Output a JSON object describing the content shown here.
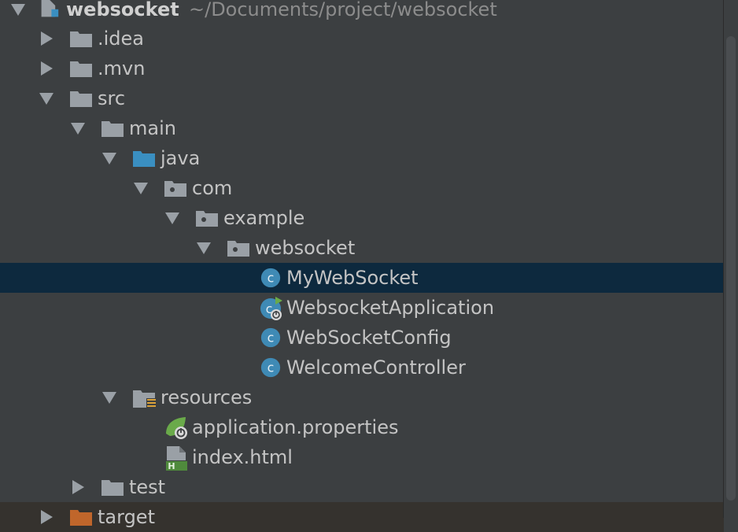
{
  "project": {
    "name": "websocket",
    "path": "~/Documents/project/websocket"
  },
  "tree": {
    "idea": ".idea",
    "mvn": ".mvn",
    "src": "src",
    "main": "main",
    "java": "java",
    "com": "com",
    "example": "example",
    "websocket_pkg": "websocket",
    "classes": [
      "MyWebSocket",
      "WebsocketApplication",
      "WebSocketConfig",
      "WelcomeController"
    ],
    "resources": "resources",
    "app_props": "application.properties",
    "index_html": "index.html",
    "test": "test",
    "target": "target"
  },
  "icons": {
    "folder": "folder-icon",
    "source_folder": "source-folder-icon",
    "package": "package-icon",
    "class": "class-icon",
    "spring_app": "spring-boot-class-icon",
    "resources_folder": "resources-folder-icon",
    "properties": "spring-properties-icon",
    "html": "html-file-icon"
  },
  "colors": {
    "background": "#3c3f41",
    "selected": "#0d293e",
    "folder": "#9aa0a6",
    "source_folder": "#3a8fc1",
    "class_badge": "#3f8ab5",
    "spring_green": "#6aaa4a",
    "target_orange": "#c0662b"
  }
}
